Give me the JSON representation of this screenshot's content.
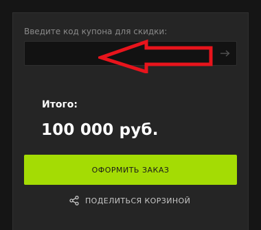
{
  "coupon": {
    "label": "Введите код купона для скидки:",
    "value": "",
    "placeholder": "",
    "submit_icon": "arrow-right-icon"
  },
  "annotation": {
    "icon": "red-arrow-annotation-icon",
    "color": "#e8141c"
  },
  "total": {
    "label": "Итого:",
    "value": "100 000 руб."
  },
  "order_button": {
    "label": "ОФОРМИТЬ ЗАКАЗ",
    "color": "#a4dc04"
  },
  "share": {
    "icon": "share-icon",
    "label": "ПОДЕЛИТЬСЯ КОРЗИНОЙ"
  }
}
